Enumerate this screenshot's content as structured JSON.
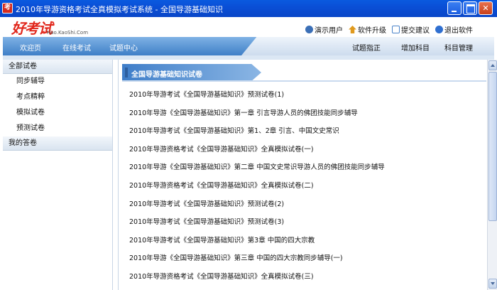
{
  "window": {
    "icon_glyph": "考",
    "title": "2010年导游资格考试全真模拟考试系统 - 全国导游基础知识",
    "min_icon": "minimize-icon",
    "max_icon": "maximize-icon",
    "close_icon": "close-icon",
    "close_glyph": "✕"
  },
  "header": {
    "logo_text": "好考试",
    "logo_sub": "Hao.KaoShi.Com",
    "links": [
      {
        "label": "演示用户",
        "icon": "user-icon",
        "color": "#3b6fb6"
      },
      {
        "label": "软件升级",
        "icon": "upgrade-icon",
        "color": "#e09a1e"
      },
      {
        "label": "提交建议",
        "icon": "suggest-icon",
        "color": "#4a83c9"
      },
      {
        "label": "退出软件",
        "icon": "exit-icon",
        "color": "#2f6fd0"
      }
    ]
  },
  "nav": {
    "left": [
      "欢迎页",
      "在线考试",
      "试题中心"
    ],
    "right": [
      "试题指正",
      "增加科目",
      "科目管理"
    ]
  },
  "sidebar": {
    "category": "全部试卷",
    "items": [
      "同步辅导",
      "考点精粹",
      "模拟试卷",
      "预测试卷"
    ],
    "my": "我的答卷"
  },
  "main": {
    "panel_title": "全国导游基础知识试卷",
    "items": [
      "2010年导游考试《全国导游基础知识》预测试卷(1)",
      "2010年导游《全国导游基础知识》第一章 引言导游人员的佛团技能同步辅导",
      "2010年导游考试《全国导游基础知识》第1、2章 引言、中国文史常识",
      "2010年导游资格考试《全国导游基础知识》全真模拟试卷(一)",
      "2010年导游《全国导游基础知识》第二章 中国文史常识导游人员的佛团技能同步辅导",
      "2010年导游资格考试《全国导游基础知识》全真模拟试卷(二)",
      "2010年导游考试《全国导游基础知识》预测试卷(2)",
      "2010年导游考试《全国导游基础知识》预测试卷(3)",
      "2010年导游考试《全国导游基础知识》第3章 中国的四大宗教",
      "2010年导游《全国导游基础知识》第三章 中国的四大宗教同步辅导(一)",
      "2010年导游资格考试《全国导游基础知识》全真模拟试卷(三)"
    ]
  },
  "colors": {
    "titlebar": "#0a4fd6",
    "nav": "#3f7fc7",
    "logo": "#e1271c",
    "panel_head": "#3f7ec9"
  }
}
